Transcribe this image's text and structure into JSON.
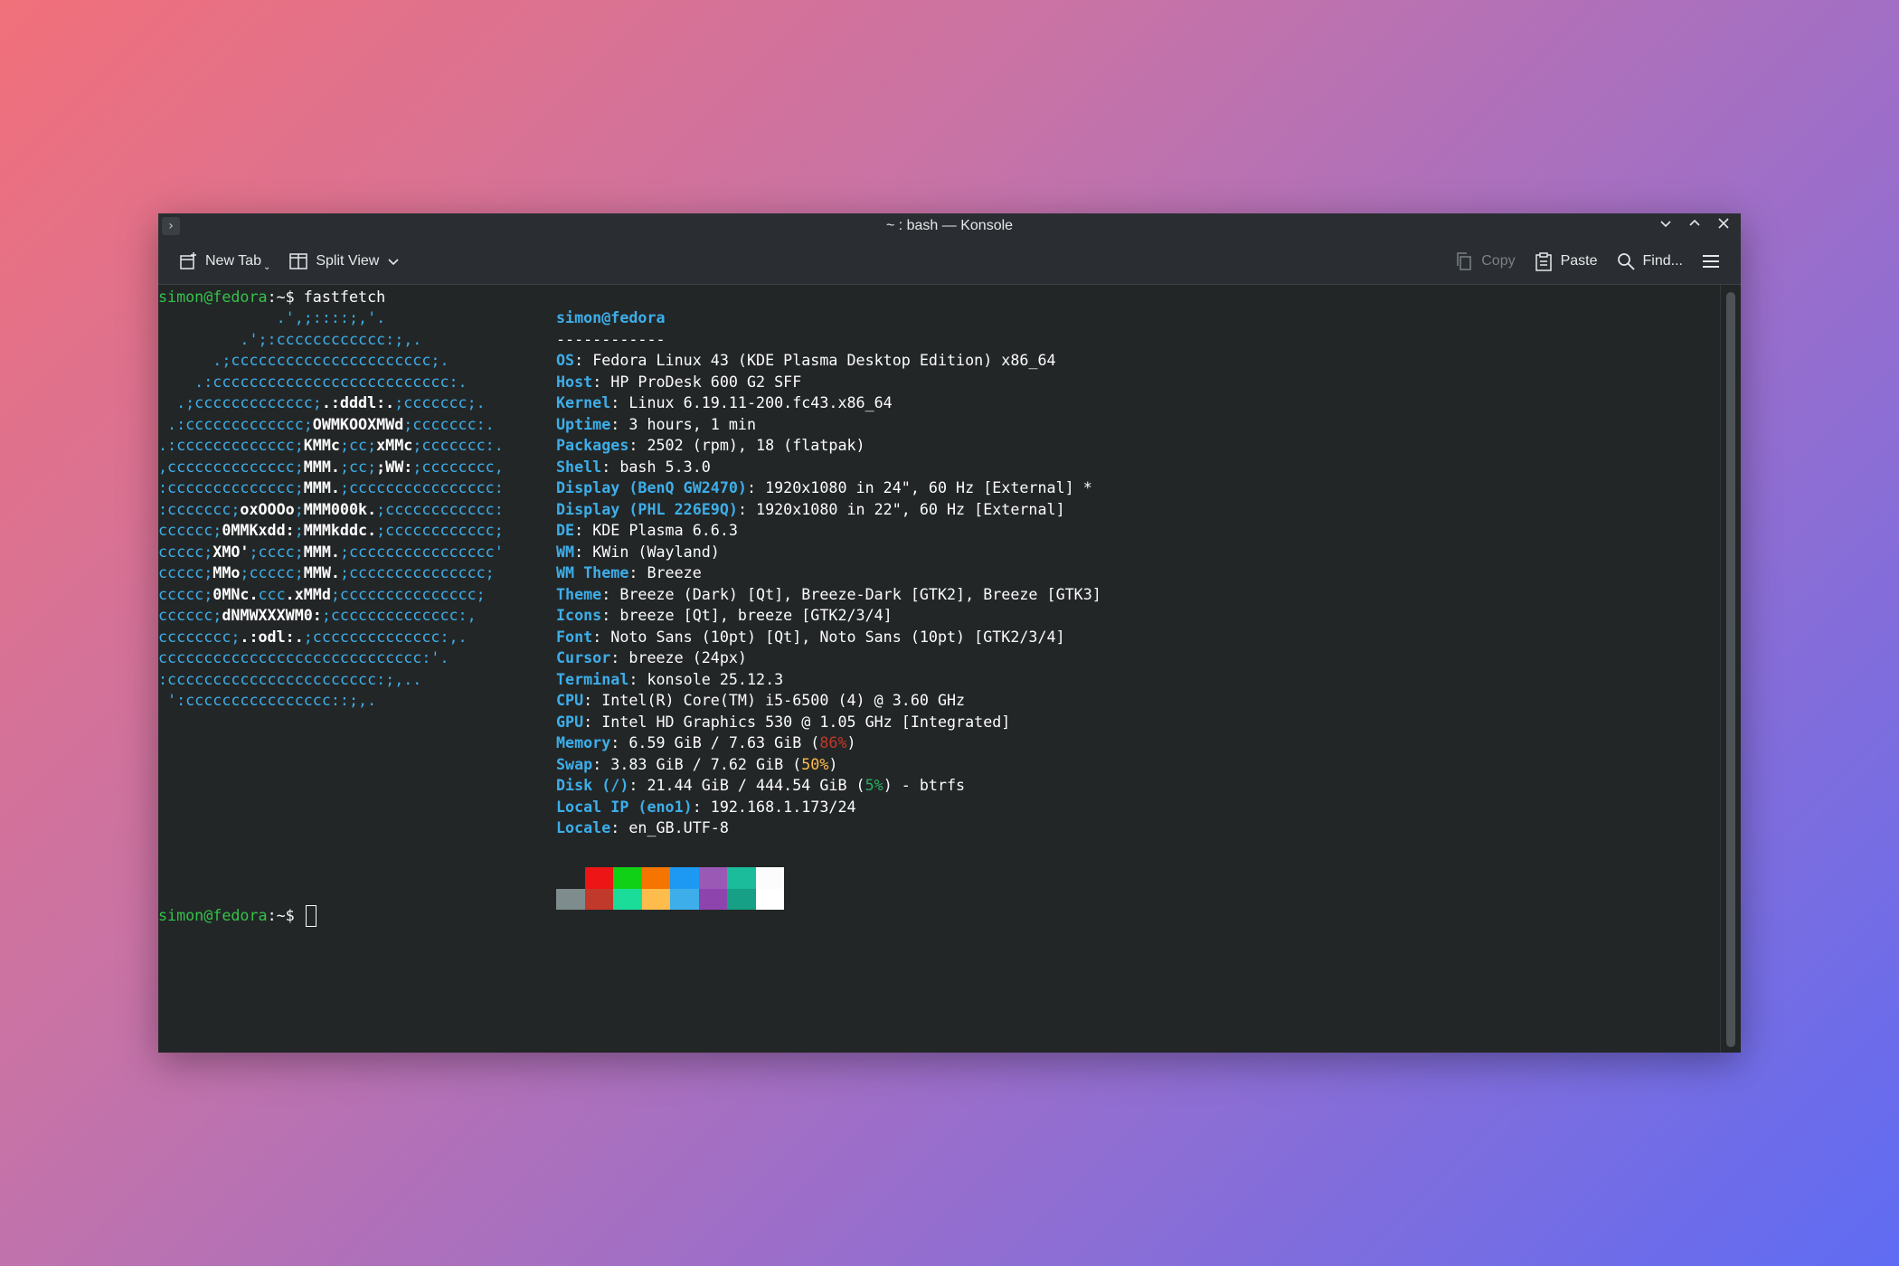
{
  "window": {
    "title": "~ : bash — Konsole",
    "menu_glyph": "›",
    "controls": {
      "minimize": "⌄",
      "maximize": "⌃",
      "close": "✕"
    }
  },
  "toolbar": {
    "new_tab": "New Tab",
    "split_view": "Split View",
    "copy": "Copy",
    "paste": "Paste",
    "find": "Find..."
  },
  "terminal": {
    "prompt_user": "simon@fedora",
    "prompt_sep": ":~$ ",
    "command": "fastfetch",
    "logo_lines": [
      [
        "             .',;::::;,'.",
        ""
      ],
      [
        "         .';:cccccccccccc:;,.",
        ""
      ],
      [
        "      .;cccccccccccccccccccccc;.",
        ""
      ],
      [
        "    .:cccccccccccccccccccccccccc:.",
        ""
      ],
      [
        "  .;ccccccccccccc;",
        ".:dddl:.",
        ";ccccccc;.",
        ""
      ],
      [
        " .:ccccccccccccc;",
        "OWMKOOXMWd",
        ";ccccccc:.",
        ""
      ],
      [
        ".:ccccccccccccc;",
        "KMMc",
        ";cc;",
        "xMMc",
        ";ccccccc:.",
        ""
      ],
      [
        ",cccccccccccccc;",
        "MMM.",
        ";cc;",
        ";WW:",
        ";cccccccc,",
        ""
      ],
      [
        ":cccccccccccccc;",
        "MMM.",
        ";cccccccccccccccc:",
        ""
      ],
      [
        ":ccccccc;",
        "oxOOOo",
        ";",
        "MMM000k.",
        ";cccccccccccc:",
        ""
      ],
      [
        "cccccc;",
        "0MMKxdd:",
        ";",
        "MMMkddc.",
        ";cccccccccccc;",
        ""
      ],
      [
        "ccccc;",
        "XMO'",
        ";cccc;",
        "MMM.",
        ";cccccccccccccccc'",
        ""
      ],
      [
        "ccccc;",
        "MMo",
        ";ccccc;",
        "MMW.",
        ";ccccccccccccccc;",
        ""
      ],
      [
        "ccccc;",
        "0MNc.",
        "ccc",
        ".xMMd",
        ";ccccccccccccccc;",
        ""
      ],
      [
        "cccccc;",
        "dNMWXXXWM0:",
        ";cccccccccccccc:,",
        ""
      ],
      [
        "cccccccc;",
        ".:odl:.",
        ";cccccccccccccc:,.",
        ""
      ],
      [
        "ccccccccccccccccccccccccccccc:'.",
        ""
      ],
      [
        ":ccccccccccccccccccccccc:;,..",
        ""
      ],
      [
        " ':cccccccccccccccc::;,.",
        ""
      ]
    ],
    "header": "simon@fedora",
    "separator": "------------",
    "info": [
      {
        "key": "OS",
        "value": "Fedora Linux 43 (KDE Plasma Desktop Edition) x86_64"
      },
      {
        "key": "Host",
        "value": "HP ProDesk 600 G2 SFF"
      },
      {
        "key": "Kernel",
        "value": "Linux 6.19.11-200.fc43.x86_64"
      },
      {
        "key": "Uptime",
        "value": "3 hours, 1 min"
      },
      {
        "key": "Packages",
        "value": "2502 (rpm), 18 (flatpak)"
      },
      {
        "key": "Shell",
        "value": "bash 5.3.0"
      },
      {
        "key": "Display (BenQ GW2470)",
        "value": "1920x1080 in 24\", 60 Hz [External] *"
      },
      {
        "key": "Display (PHL 226E9Q)",
        "value": "1920x1080 in 22\", 60 Hz [External]"
      },
      {
        "key": "DE",
        "value": "KDE Plasma 6.6.3"
      },
      {
        "key": "WM",
        "value": "KWin (Wayland)"
      },
      {
        "key": "WM Theme",
        "value": "Breeze"
      },
      {
        "key": "Theme",
        "value": "Breeze (Dark) [Qt], Breeze-Dark [GTK2], Breeze [GTK3]"
      },
      {
        "key": "Icons",
        "value": "breeze [Qt], breeze [GTK2/3/4]"
      },
      {
        "key": "Font",
        "value": "Noto Sans (10pt) [Qt], Noto Sans (10pt) [GTK2/3/4]"
      },
      {
        "key": "Cursor",
        "value": "breeze (24px)"
      },
      {
        "key": "Terminal",
        "value": "konsole 25.12.3"
      },
      {
        "key": "CPU",
        "value": "Intel(R) Core(TM) i5-6500 (4) @ 3.60 GHz"
      },
      {
        "key": "GPU",
        "value": "Intel HD Graphics 530 @ 1.05 GHz [Integrated]"
      },
      {
        "key": "Memory",
        "value": "6.59 GiB / 7.63 GiB (",
        "pct": "86%",
        "pct_class": "pct-red",
        "tail": ")"
      },
      {
        "key": "Swap",
        "value": "3.83 GiB / 7.62 GiB (",
        "pct": "50%",
        "pct_class": "pct-yellow",
        "tail": ")"
      },
      {
        "key": "Disk (/)",
        "value": "21.44 GiB / 444.54 GiB (",
        "pct": "5%",
        "pct_class": "pct-green",
        "tail": ") - btrfs"
      },
      {
        "key": "Local IP (eno1)",
        "value": "192.168.1.173/24"
      },
      {
        "key": "Locale",
        "value": "en_GB.UTF-8"
      }
    ],
    "palette_top": [
      "#232627",
      "#ed1515",
      "#11d116",
      "#f67400",
      "#1d99f3",
      "#9b59b6",
      "#1abc9c",
      "#fcfcfc"
    ],
    "palette_bottom": [
      "#7f8c8d",
      "#c0392b",
      "#1cdc9a",
      "#fdbc4b",
      "#3daee9",
      "#8e44ad",
      "#16a085",
      "#ffffff"
    ]
  },
  "colors": {
    "prompt_green": "#33c24a",
    "accent_blue": "#3daee9",
    "terminal_bg": "#232627"
  }
}
